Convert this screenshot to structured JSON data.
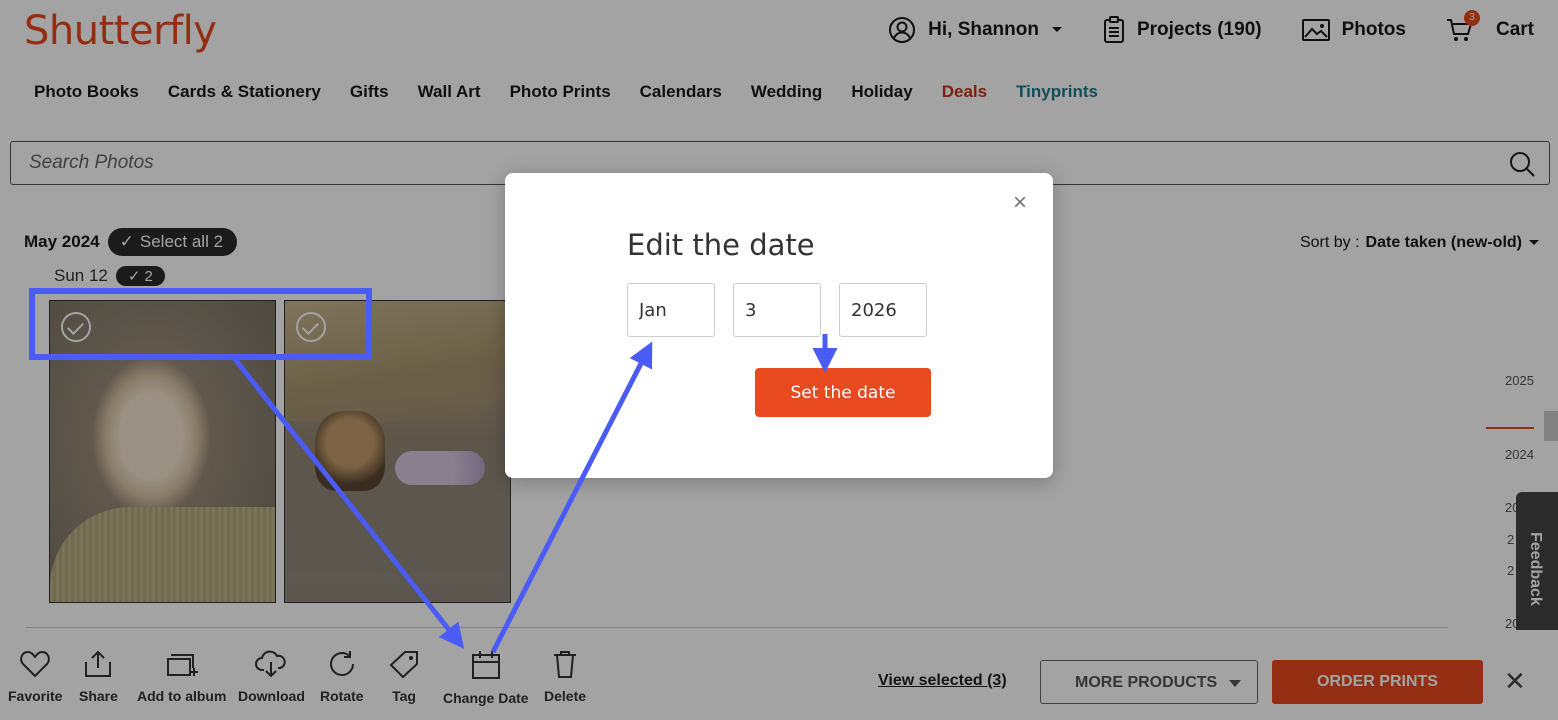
{
  "header": {
    "logo": "Shutterfly",
    "greeting": "Hi, Shannon",
    "projects": "Projects (190)",
    "photos": "Photos",
    "cart": "Cart",
    "cart_count": "3"
  },
  "categories": [
    "Photo Books",
    "Cards & Stationery",
    "Gifts",
    "Wall Art",
    "Photo Prints",
    "Calendars",
    "Wedding",
    "Holiday",
    "Deals",
    "Tinyprints"
  ],
  "search": {
    "placeholder": "Search Photos"
  },
  "group": {
    "month": "May 2024",
    "select_all": "Select all 2"
  },
  "sort": {
    "label": "Sort by :",
    "value": "Date taken (new-old)"
  },
  "day": {
    "label": "Sun 12",
    "count": "2"
  },
  "timeline": [
    "2025",
    "2024",
    "20",
    "2",
    "2",
    "20"
  ],
  "feedback": "Feedback",
  "toolbar": {
    "favorite": "Favorite",
    "share": "Share",
    "add_to_album": "Add to album",
    "download": "Download",
    "rotate": "Rotate",
    "tag": "Tag",
    "change_date": "Change Date",
    "delete": "Delete",
    "view_selected": "View selected (3)",
    "more_products": "MORE PRODUCTS",
    "order_prints": "ORDER PRINTS"
  },
  "modal": {
    "title": "Edit the date",
    "month": "Jan",
    "day": "3",
    "year": "2026",
    "button": "Set the date"
  },
  "colors": {
    "brand": "#e8491f",
    "annotation": "#4a5cf5",
    "tinyprints": "#1b7a8c"
  }
}
